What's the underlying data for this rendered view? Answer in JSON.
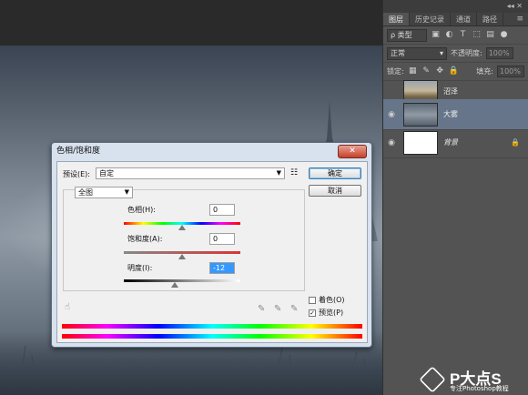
{
  "panel": {
    "strip": "◂◂ ✕",
    "tabs": [
      "图层",
      "历史记录",
      "通道",
      "路径"
    ],
    "tab_menu": "≡",
    "filter_label": "ρ 类型",
    "blend_mode": "正常",
    "opacity_label": "不透明度:",
    "opacity_value": "100%",
    "lock_label": "锁定:",
    "fill_label": "填充:",
    "fill_value": "100%",
    "layers": [
      {
        "name": "沼泽",
        "visible": false,
        "selected": false
      },
      {
        "name": "大雾",
        "visible": true,
        "selected": true
      },
      {
        "name": "背景",
        "visible": true,
        "selected": false,
        "locked": true
      }
    ]
  },
  "dialog": {
    "title": "色相/饱和度",
    "close": "✕",
    "preset_label": "预设(E):",
    "preset_value": "自定",
    "preset_menu_icon": "☷",
    "ok": "确定",
    "cancel": "取消",
    "channel": "全图",
    "hue_label": "色相(H):",
    "hue_value": "0",
    "sat_label": "饱和度(A):",
    "sat_value": "0",
    "light_label": "明度(I):",
    "light_value": "-12",
    "colorize_label": "着色(O)",
    "colorize_checked": false,
    "preview_label": "预览(P)",
    "preview_checked": true
  },
  "watermark": {
    "title": "P大点S",
    "subtitle": "专注Photoshop教程"
  }
}
